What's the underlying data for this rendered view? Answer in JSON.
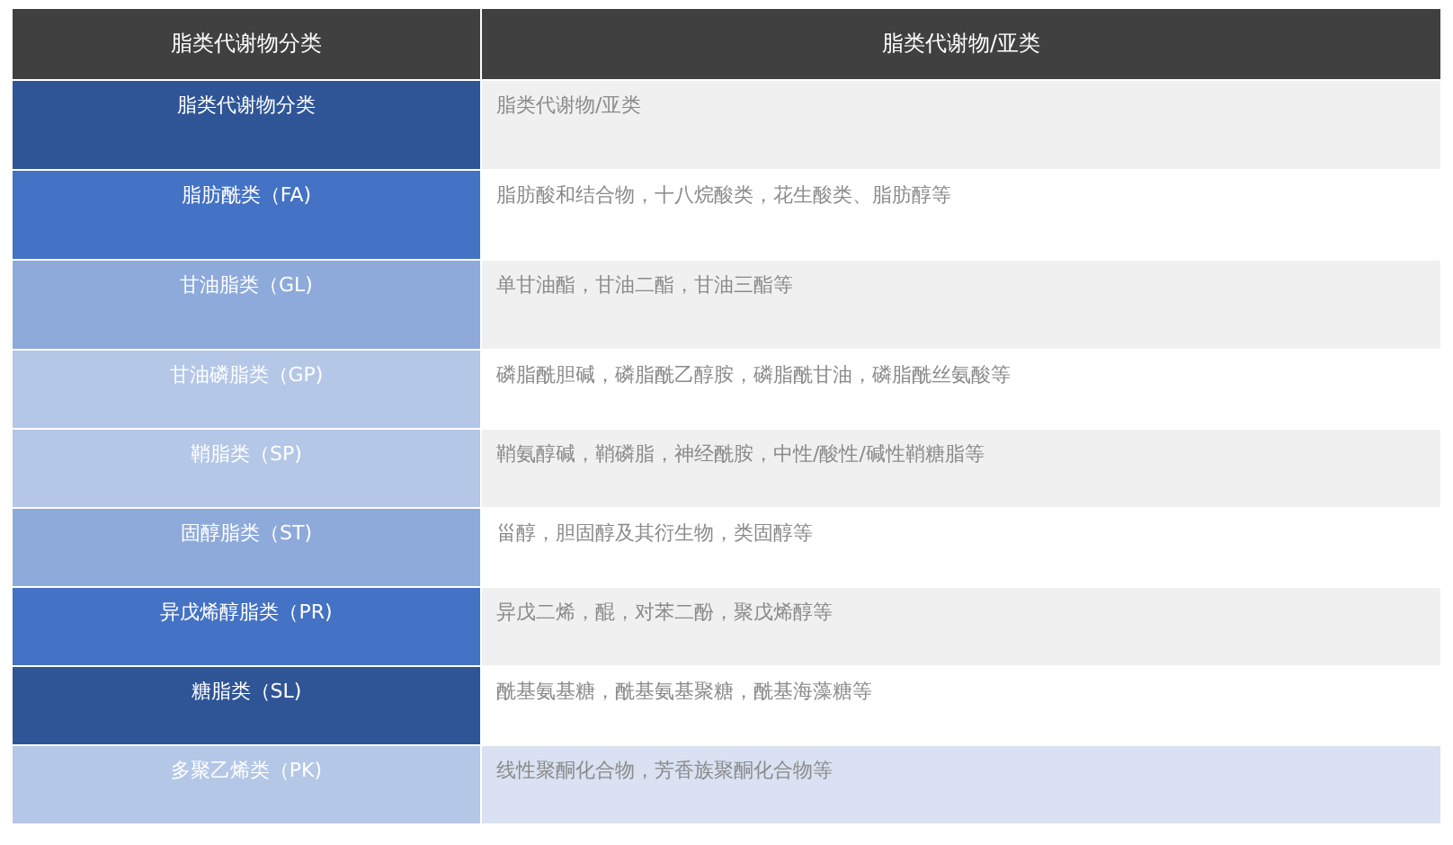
{
  "table": {
    "columns": [
      "脂类代谢物分类",
      "脂类代谢物/亚类"
    ],
    "rows": [
      {
        "category": "脂类代谢物分类",
        "detail": "脂类代谢物/亚类",
        "color": "#2f5597",
        "shaded": true,
        "highlighted": false
      },
      {
        "category": "脂肪酰类（FA)",
        "detail": "脂肪酸和结合物，十八烷酸类，花生酸类、脂肪醇等",
        "color": "#4472c4",
        "shaded": false,
        "highlighted": false
      },
      {
        "category": "甘油脂类（GL)",
        "detail": "单甘油酯，甘油二酯，甘油三酯等",
        "color": "#8eaadb",
        "shaded": true,
        "highlighted": false
      },
      {
        "category": "甘油磷脂类（GP)",
        "detail": "磷脂酰胆碱，磷脂酰乙醇胺，磷脂酰甘油，磷脂酰丝氨酸等",
        "color": "#b4c7e7",
        "shaded": false,
        "highlighted": false
      },
      {
        "category": "鞘脂类（SP)",
        "detail": "鞘氨醇碱，鞘磷脂，神经酰胺，中性/酸性/碱性鞘糖脂等",
        "color": "#b4c7e7",
        "shaded": true,
        "highlighted": false
      },
      {
        "category": "固醇脂类（ST)",
        "detail": "甾醇，胆固醇及其衍生物，类固醇等",
        "color": "#8eaadb",
        "shaded": false,
        "highlighted": false
      },
      {
        "category": "异戊烯醇脂类（PR)",
        "detail": "异戊二烯，醌，对苯二酚，聚戊烯醇等",
        "color": "#4472c4",
        "shaded": true,
        "highlighted": false
      },
      {
        "category": "糖脂类（SL)",
        "detail": "酰基氨基糖，酰基氨基聚糖，酰基海藻糖等",
        "color": "#2f5597",
        "shaded": false,
        "highlighted": false
      },
      {
        "category": "多聚乙烯类（PK)",
        "detail": "线性聚酮化合物，芳香族聚酮化合物等",
        "color": "#b4c7e7",
        "shaded": false,
        "highlighted": true
      }
    ]
  }
}
